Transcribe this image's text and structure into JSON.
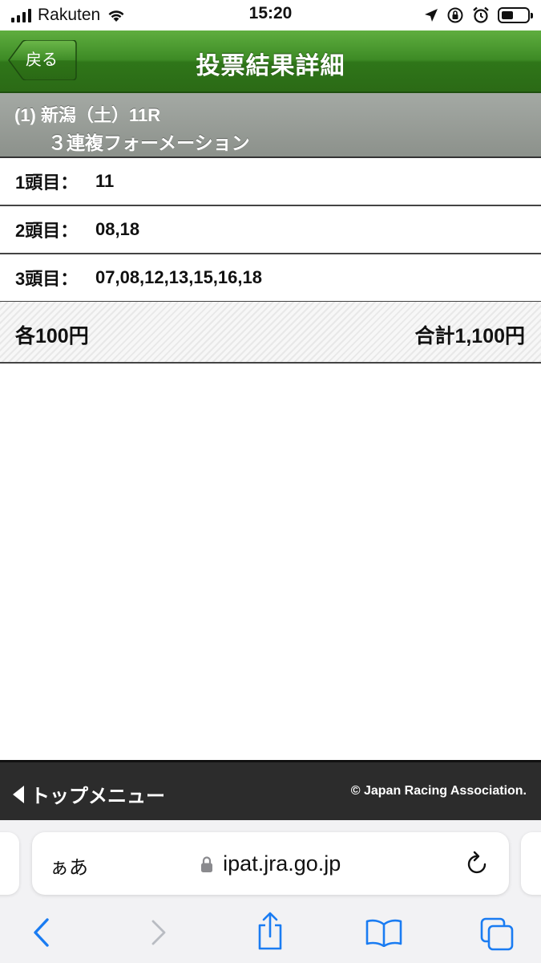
{
  "status_bar": {
    "carrier": "Rakuten",
    "time": "15:20"
  },
  "header": {
    "back_label": "戻る",
    "title": "投票結果詳細"
  },
  "race": {
    "line1": "(1) 新潟（土）11R",
    "line2": "３連複フォーメーション"
  },
  "selections": [
    {
      "label": "1頭目：",
      "value": "11"
    },
    {
      "label": "2頭目：",
      "value": "08,18"
    },
    {
      "label": "3頭目：",
      "value": "07,08,12,13,15,16,18"
    }
  ],
  "totals": {
    "each": "各100円",
    "sum": "合計1,100円"
  },
  "footer": {
    "top_menu": "トップメニュー",
    "copyright": "© Japan Racing Association."
  },
  "browser": {
    "aa_label": "ぁあ",
    "url": "ipat.jra.go.jp"
  },
  "colors": {
    "header_green": "#3d8a25",
    "race_band_grey": "#9a9f99",
    "footer_dark": "#2c2c2c",
    "ios_blue": "#1a7cf2"
  },
  "icons": [
    "signal-icon",
    "wifi-icon",
    "location-icon",
    "orientation-lock-icon",
    "alarm-icon",
    "battery-icon",
    "lock-icon",
    "reload-icon",
    "back-arrow-icon",
    "forward-arrow-icon",
    "share-icon",
    "bookmarks-icon",
    "tabs-icon"
  ]
}
